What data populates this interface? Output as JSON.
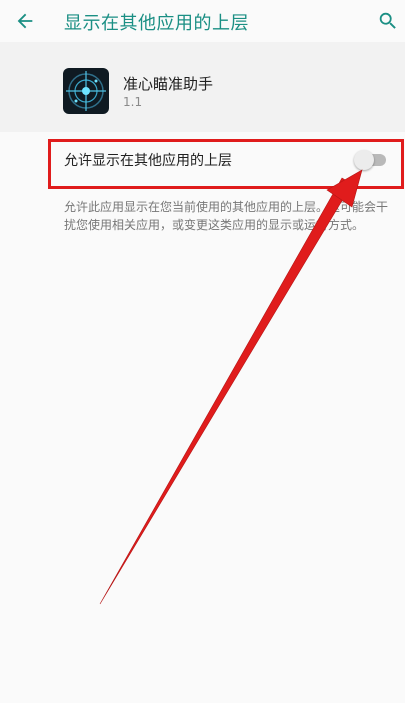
{
  "app_bar": {
    "title": "显示在其他应用的上层",
    "back_icon": "arrow-back-icon",
    "search_icon": "search-icon"
  },
  "app_info": {
    "name": "准心瞄准助手",
    "version": "1.1"
  },
  "setting": {
    "label": "允许显示在其他应用的上层",
    "enabled": false
  },
  "description": "允许此应用显示在您当前使用的其他应用的上层。这可能会干扰您使用相关应用，或变更这类应用的显示或运行方式。",
  "colors": {
    "accent": "#1b8f84",
    "annotation": "#e01c1c"
  }
}
